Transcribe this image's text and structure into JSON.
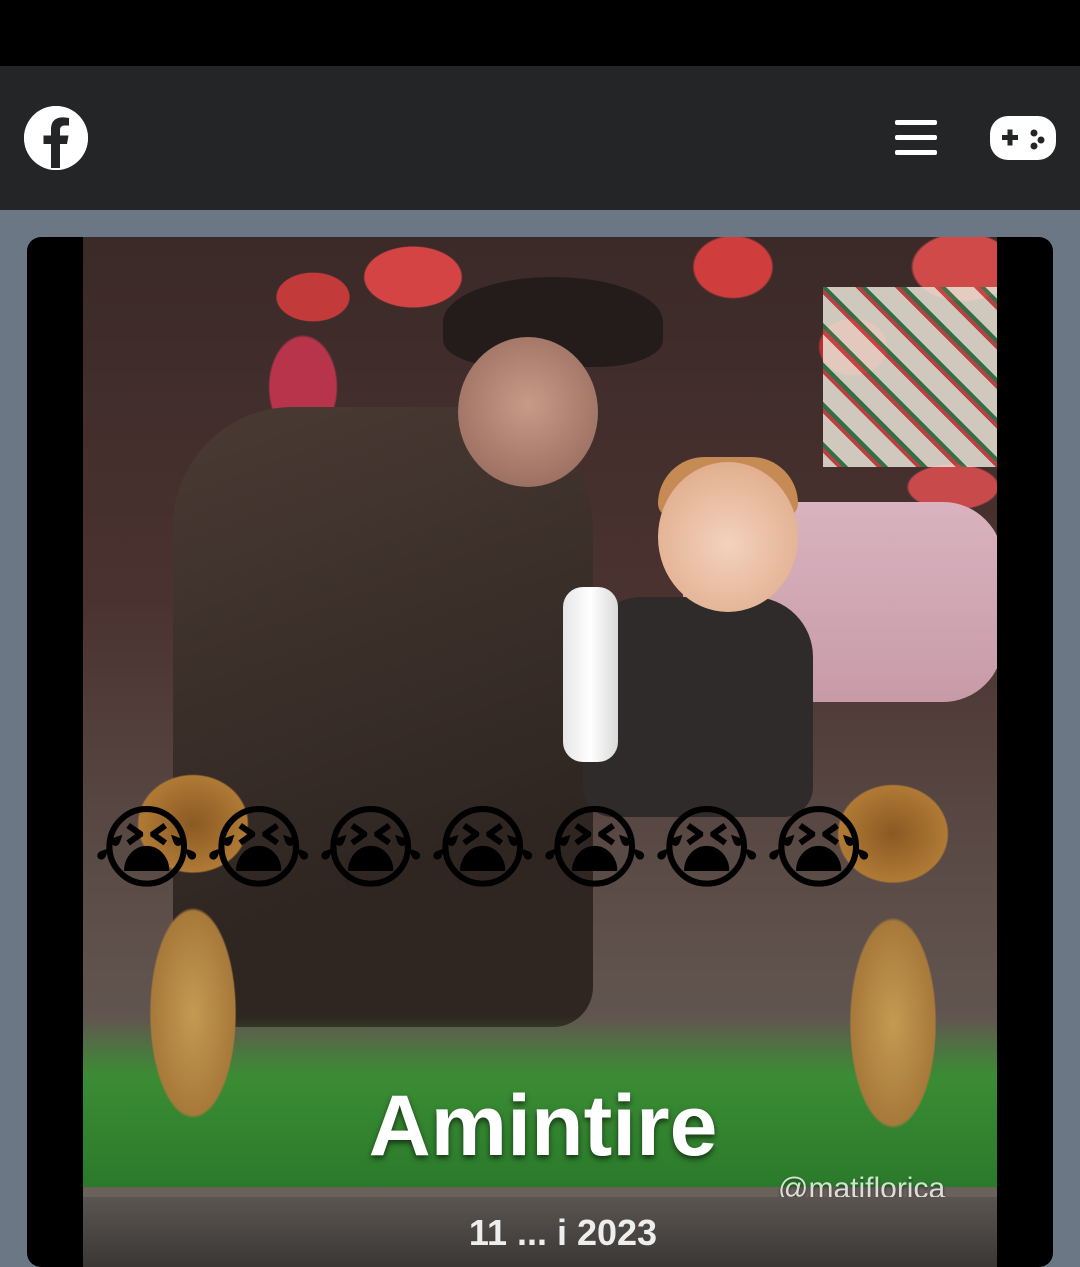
{
  "header": {
    "logo_icon": "facebook-logo-icon",
    "menu_icon": "hamburger-menu-icon",
    "gaming_icon": "gamepad-icon",
    "brand_color": "#1877f2",
    "bar_color": "#242526"
  },
  "post": {
    "image_caption": "Amintire",
    "watermark": "@matiflorica",
    "date_overlay": "11 ... i 2023",
    "emoji": [
      "😭",
      "😭",
      "😭",
      "😭",
      "😭",
      "😭",
      "😭"
    ]
  }
}
